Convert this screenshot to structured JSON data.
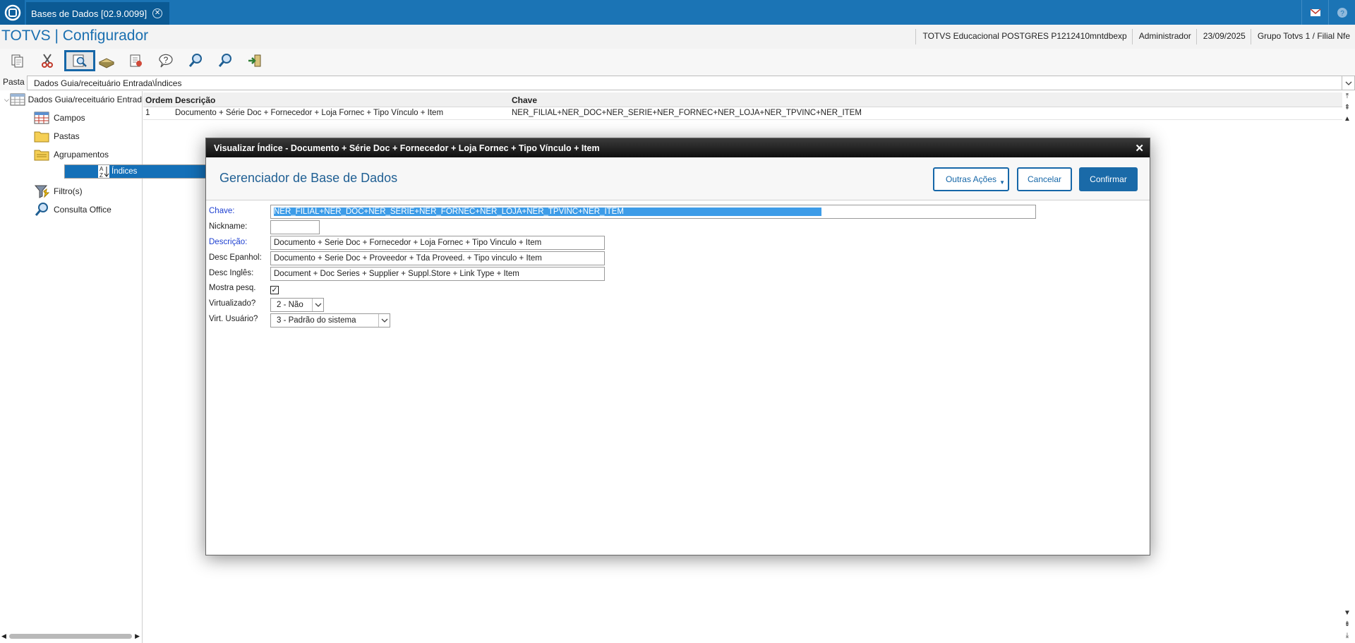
{
  "tab": {
    "title": "Bases de Dados [02.9.0099]"
  },
  "header": {
    "app_title": "TOTVS | Configurador",
    "environment": "TOTVS Educacional POSTGRES P1212410mntdbexp",
    "user": "Administrador",
    "date": "23/09/2025",
    "company": "Grupo Totvs 1 / Filial Nfe"
  },
  "toolbar": {
    "icons": [
      "copy-icon",
      "cut-icon",
      "paste-icon",
      "book-icon",
      "edit-document-icon",
      "help-icon",
      "search-icon",
      "search-next-icon",
      "exit-icon",
      "view-index-icon"
    ]
  },
  "folder": {
    "label": "Pasta",
    "path": "Dados Guia/receituário Entrada\\Índices"
  },
  "tree": {
    "root": "Dados Guia/receituário Entrad",
    "items": [
      {
        "label": "Campos",
        "icon": "table-icon"
      },
      {
        "label": "Pastas",
        "icon": "folder-icon"
      },
      {
        "label": "Agrupamentos",
        "icon": "folder-group-icon"
      },
      {
        "label": "Índices",
        "icon": "sort-index-icon"
      },
      {
        "label": "Filtro(s)",
        "icon": "filter-icon"
      },
      {
        "label": "Consulta Office",
        "icon": "magnifier-icon"
      }
    ]
  },
  "table": {
    "columns": [
      "Ordem",
      "Descrição",
      "Chave"
    ],
    "rows": [
      {
        "ordem": "1",
        "descricao": "Documento + Série Doc + Fornecedor + Loja Fornec + Tipo Vínculo + Item",
        "chave": "NER_FILIAL+NER_DOC+NER_SERIE+NER_FORNEC+NER_LOJA+NER_TPVINC+NER_ITEM"
      }
    ]
  },
  "dialog": {
    "title": "Visualizar Índice - Documento + Série Doc + Fornecedor + Loja Fornec + Tipo Vínculo + Item",
    "heading": "Gerenciador de Base de Dados",
    "buttons": {
      "more": "Outras Ações",
      "cancel": "Cancelar",
      "confirm": "Confirmar"
    },
    "fields": {
      "chave": {
        "label": "Chave:",
        "value": "NER_FILIAL+NER_DOC+NER_SERIE+NER_FORNEC+NER_LOJA+NER_TPVINC+NER_ITEM"
      },
      "nickname": {
        "label": "Nickname:",
        "value": ""
      },
      "descricao": {
        "label": "Descrição:",
        "value": "Documento + Serie Doc + Fornecedor + Loja Fornec + Tipo Vinculo + Item"
      },
      "desc_espanhol": {
        "label": "Desc Epanhol:",
        "value": "Documento + Serie Doc + Proveedor + Tda Proveed. + Tipo vinculo + Item"
      },
      "desc_ingles": {
        "label": "Desc Inglês:",
        "value": "Document + Doc Series + Supplier + Suppl.Store + Link Type + Item"
      },
      "mostra_pesq": {
        "label": "Mostra pesq.",
        "checked": true
      },
      "virtualizado": {
        "label": "Virtualizado?",
        "value": "2 - Não"
      },
      "virt_usuario": {
        "label": "Virt. Usuário?",
        "value": "3 - Padrão do sistema"
      }
    }
  }
}
